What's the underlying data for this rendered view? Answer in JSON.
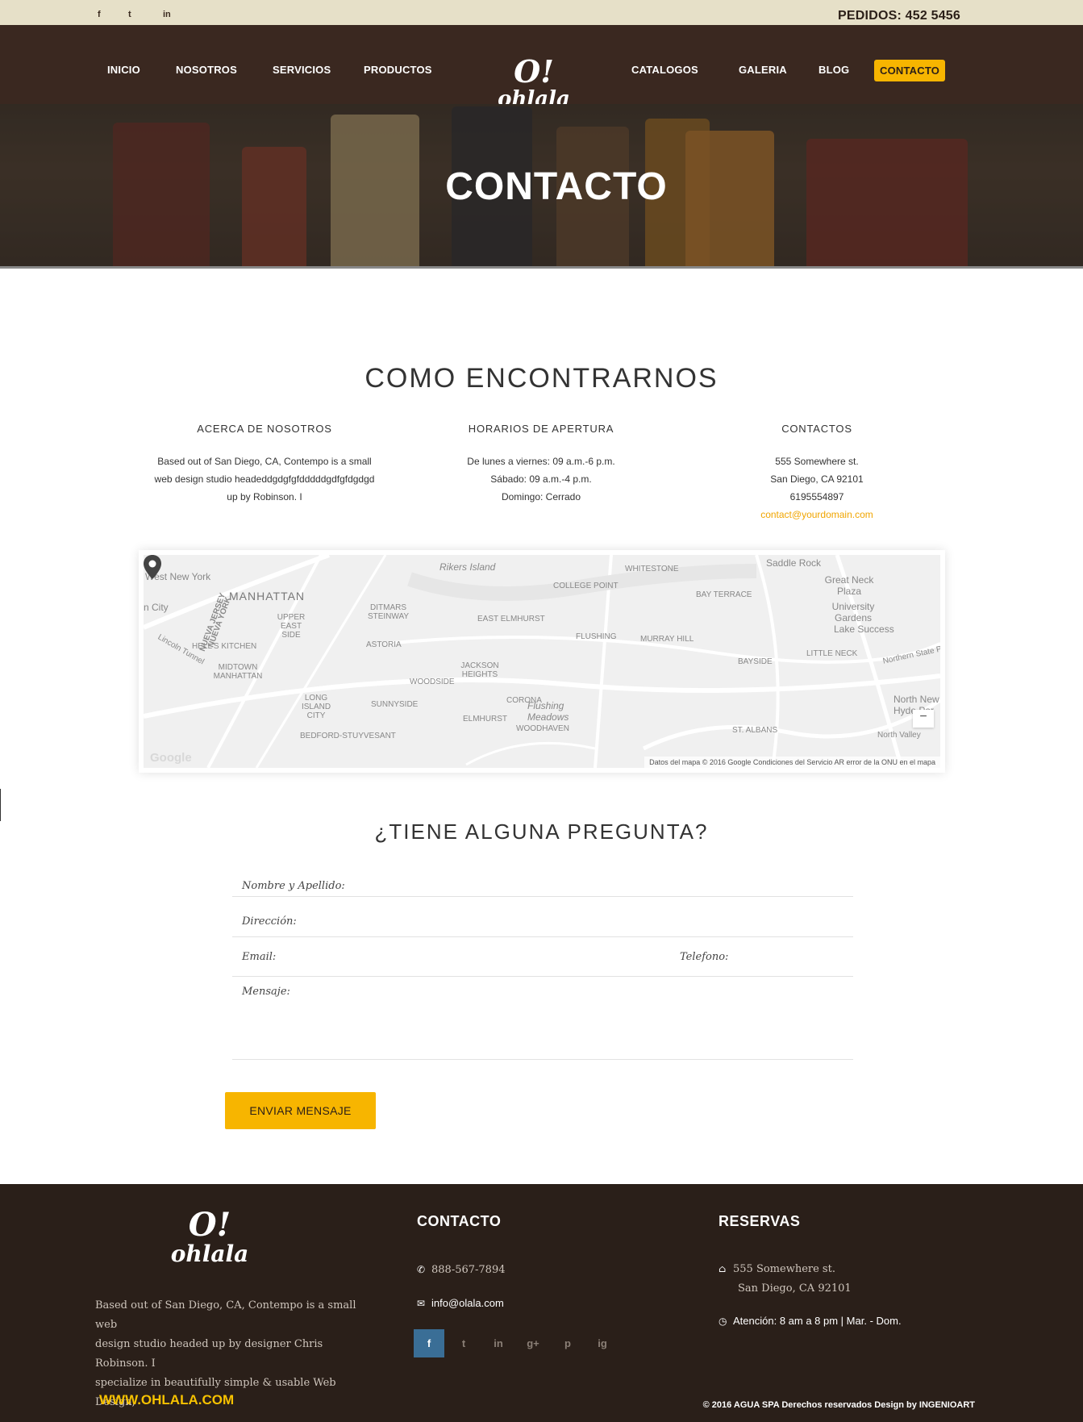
{
  "topbar": {
    "social": [
      "f",
      "t",
      "in"
    ],
    "orders_label": "PEDIDOS:",
    "orders_number": "452 5456"
  },
  "nav": {
    "left": [
      "INICIO",
      "NOSOTROS",
      "SERVICIOS",
      "PRODUCTOS"
    ],
    "right": [
      "CATALOGOS",
      "GALERIA",
      "BLOG",
      "CONTACTO"
    ],
    "active": "CONTACTO",
    "logo_top": "O!",
    "logo_word": "ohlala"
  },
  "hero": {
    "title": "CONTACTO"
  },
  "find_us": {
    "title": "COMO ENCONTRARNOS",
    "about": {
      "heading": "ACERCA DE NOSOTROS",
      "text_lines": [
        "Based out of San Diego, CA, Contempo is a small",
        "web design studio headeddgdgfgfdddddgdfgfdgdgd",
        "up by Robinson. I"
      ]
    },
    "hours": {
      "heading": "HORARIOS DE APERTURA",
      "lines": [
        "De lunes a viernes: 09 a.m.-6 p.m.",
        "Sábado: 09 a.m.-4 p.m.",
        "Domingo: Cerrado"
      ]
    },
    "contacts": {
      "heading": "CONTACTOS",
      "lines": [
        "555 Somewhere st.",
        "San Diego, CA 92101",
        "6195554897"
      ],
      "email": "contact@yourdomain.com"
    }
  },
  "map": {
    "labels": {
      "west_new_york": "West New York",
      "manhattan": "MANHATTAN",
      "n_city": "n City",
      "nueva_jersey": "NUEVA JERSEY",
      "nueva_york": "NUEVA YORK",
      "rikers": "Rikers Island",
      "whitestone": "WHITESTONE",
      "college_point": "COLLEGE POINT",
      "saddle_rock": "Saddle Rock",
      "great_neck": "Great Neck Plaza",
      "university_gardens": "University Gardens",
      "lake_success": "Lake Success",
      "bay_terrace": "BAY TERRACE",
      "ditmars": "DITMARS STEINWAY",
      "east_elmhurst": "EAST ELMHURST",
      "upper_east": "UPPER EAST SIDE",
      "hells_kitchen": "HELL'S KITCHEN",
      "astoria": "ASTORIA",
      "flushing": "FLUSHING",
      "murray_hill": "MURRAY HILL",
      "little_neck": "LITTLE NECK",
      "bayside": "BAYSIDE",
      "jackson_heights": "JACKSON HEIGHTS",
      "midtown": "MIDTOWN MANHATTAN",
      "woodside": "WOODSIDE",
      "long_island_city": "LONG ISLAND CITY",
      "sunnyside": "SUNNYSIDE",
      "corona": "CORONA",
      "flushing_meadows": "Flushing Meadows",
      "elmhurst": "ELMHURST",
      "woodhaven": "WOODHAVEN",
      "bedford": "BEDFORD-STUYVESANT",
      "st_albans": "ST. ALBANS",
      "north_new_hyde": "North New Hyde Par",
      "north_valley": "North Valley",
      "lincoln_tunnel": "Lincoln Tunnel",
      "northern_state": "Northern State Pky"
    },
    "google": "Google",
    "footer": "Datos del mapa © 2016 Google   Condiciones del Servicio   AR error de la ONU en el mapa",
    "zoom_out": "−"
  },
  "form": {
    "title": "¿TIENE ALGUNA PREGUNTA?",
    "name_label": "Nombre y Apellido:",
    "address_label": "Dirección:",
    "email_label": "Email:",
    "phone_label": "Telefono:",
    "message_label": "Mensaje:",
    "submit": "ENVIAR MENSAJE"
  },
  "footer": {
    "logo_top": "O!",
    "logo_word": "ohlala",
    "about_lines": [
      "Based out of San Diego, CA, Contempo is a small web",
      "design studio headed up by designer Chris Robinson. I",
      "specialize in beautifully simple & usable Web Design,"
    ],
    "contact_heading": "CONTACTO",
    "phone": "888-567-7894",
    "email": "info@olala.com",
    "socials": [
      "f",
      "t",
      "in",
      "g+",
      "p",
      "ig"
    ],
    "reservas_heading": "RESERVAS",
    "address_line1": "555 Somewhere st.",
    "address_line2": "San Diego, CA 92101",
    "hours": "Atención: 8 am a 8 pm  |  Mar. - Dom.",
    "www": "WWW.OHLALA.COM",
    "copyright": "© 2016   AGUA SPA   Derechos reservados Design by INGENIOART"
  },
  "colors": {
    "accent": "#f7b500",
    "nav_bg": "#3a2820",
    "footer_bg": "#2a1f19",
    "topbar_bg": "#e6e0c8"
  }
}
